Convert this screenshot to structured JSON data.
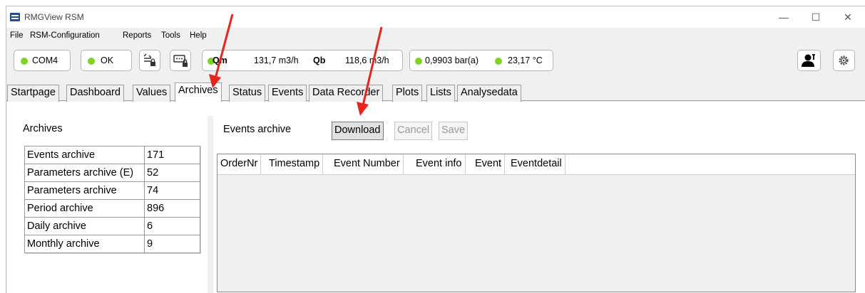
{
  "window": {
    "title": "RMGView RSM",
    "minimize": "—",
    "maximize": "☐",
    "close": "✕"
  },
  "menubar": {
    "items": [
      "File",
      "RSM-Configuration",
      "Reports",
      "Tools",
      "Help"
    ]
  },
  "toolbar": {
    "port": "COM4",
    "status": "OK",
    "qm_label": "Qm",
    "qm_value": "131,7 m3/h",
    "qb_label": "Qb",
    "qb_value": "118,6 m3/h",
    "pressure": "0,9903 bar(a)",
    "temperature": "23,17 °C",
    "status_color": "#7ed321"
  },
  "tabs": [
    "Startpage",
    "Dashboard",
    "Values",
    "Archives",
    "Status",
    "Events",
    "Data Recorder",
    "Plots",
    "Lists",
    "Analysedata"
  ],
  "active_tab": "Archives",
  "left_panel": {
    "heading": "Archives",
    "rows": [
      {
        "name": "Events archive",
        "count": "171"
      },
      {
        "name": "Parameters archive (E)",
        "count": "52"
      },
      {
        "name": "Parameters archive",
        "count": "74"
      },
      {
        "name": "Period archive",
        "count": "896"
      },
      {
        "name": "Daily archive",
        "count": "6"
      },
      {
        "name": "Monthly archive",
        "count": "9"
      }
    ]
  },
  "right_panel": {
    "heading": "Events archive",
    "download_label": "Download",
    "cancel_label": "Cancel",
    "save_label": "Save",
    "columns": [
      "OrderNr",
      "Timestamp",
      "Event Number",
      "Event info",
      "Event",
      "Eventdetail"
    ]
  },
  "annotation_color": "#e8251d"
}
